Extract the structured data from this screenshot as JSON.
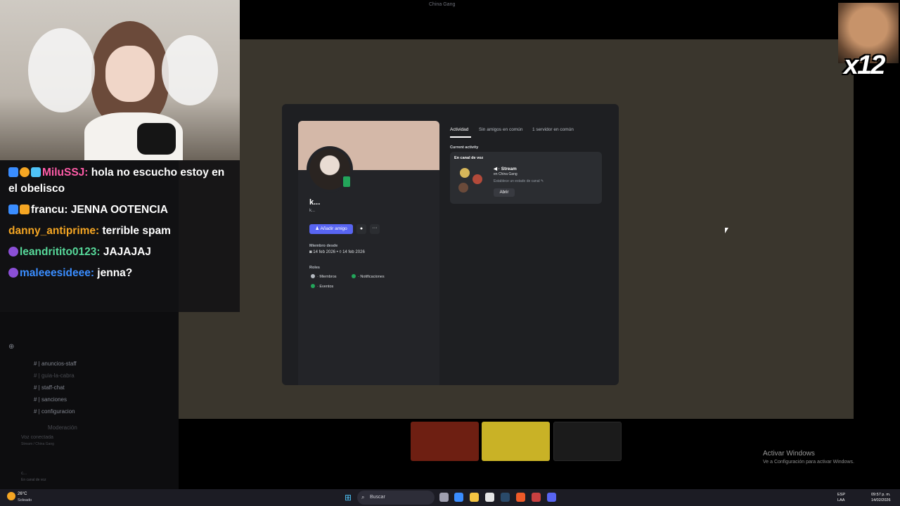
{
  "window": {
    "title": "China Gang"
  },
  "emote": {
    "count": "x12"
  },
  "chat": {
    "messages": [
      {
        "user": "MiluSSJ:",
        "text": " hola no escucho estoy en el obelisco",
        "color": "#ff5ca8"
      },
      {
        "user": "francu:",
        "text": " JENNA OOTENCIA",
        "color": "#ffffff"
      },
      {
        "user": "danny_antiprime:",
        "text": " terrible spam",
        "color": "#f5a623"
      },
      {
        "user": "leandritito0123:",
        "text": " JAJAJAJ",
        "color": "#57d99a"
      },
      {
        "user": "maleeesideee:",
        "text": " jenna?",
        "color": "#3a8dff"
      }
    ]
  },
  "sidebar": {
    "channels": [
      "anuncios-staff",
      "guia-la-cabra",
      "staff-chat",
      "sanciones",
      "configuracion",
      "Moderación"
    ],
    "voice": {
      "status": "Voz conectada",
      "server": "Stream / China Gang"
    },
    "user": {
      "name": "c...",
      "status": "En canal de voz"
    }
  },
  "profile": {
    "display_name": "k...",
    "username": "k...",
    "add_friend": "Añadir amigo",
    "member_since_label": "Miembro desde",
    "date_discord": "14 feb 2026",
    "date_server": "14 feb 2026",
    "roles_label": "Roles",
    "roles": [
      {
        "name": "Miembros",
        "color": "#b5bac1"
      },
      {
        "name": "Notificaciones",
        "color": "#23a55a"
      },
      {
        "name": "Eventos",
        "color": "#23a55a"
      }
    ],
    "tabs": [
      "Actividad",
      "Sin amigos en común",
      "1 servidor en común"
    ],
    "current_activity_label": "Current activity",
    "activity": {
      "header": "En canal de voz",
      "channel": "Stream",
      "server": "en China Gang",
      "status_hint": "Establece un estado de canal",
      "open_button": "Abrir"
    }
  },
  "windows_activation": {
    "title": "Activar Windows",
    "subtitle": "Ve a Configuración para activar Windows."
  },
  "taskbar": {
    "weather_temp": "26°C",
    "weather_desc": "Soleado",
    "search_placeholder": "Buscar",
    "lang": "ESP",
    "lang_sub": "LAA",
    "time": "09:57 p. m.",
    "date": "14/02/2026"
  }
}
